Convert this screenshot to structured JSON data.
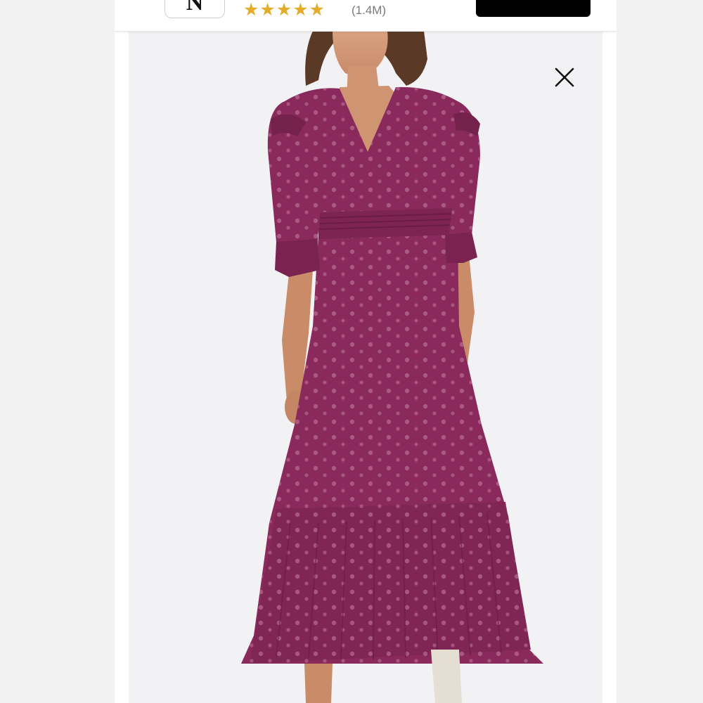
{
  "banner": {
    "app_icon_letter": "N",
    "stars": "★★★★★",
    "rating_count": "(1.4M)",
    "action_label": ""
  },
  "photo": {
    "subject": "model-in-dress",
    "dress_color": "#8a2a5c"
  },
  "icons": {
    "close": "close-icon"
  }
}
